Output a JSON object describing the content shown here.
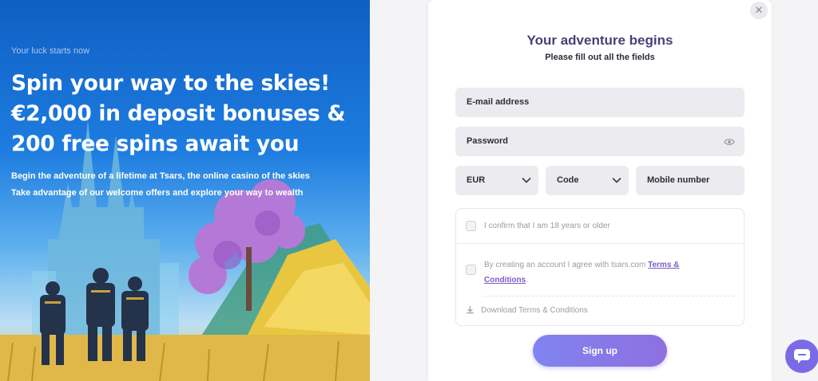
{
  "hero": {
    "tagline": "Your luck starts now",
    "headline": [
      "Spin your way to the skies!",
      "€2,000 in deposit bonuses &",
      "200 free spins await you"
    ],
    "sub": [
      "Begin the adventure of a lifetime at Tsars, the online casino of the skies",
      "Take advantage of our welcome offers and explore your way to wealth"
    ]
  },
  "form": {
    "title": "Your adventure begins",
    "subtitle": "Please fill out all the fields",
    "email_placeholder": "E-mail address",
    "password_placeholder": "Password",
    "currency_value": "EUR",
    "code_value": "Code",
    "mobile_placeholder": "Mobile number",
    "age_confirm": "I confirm that I am 18 years or older",
    "terms_prefix": "By creating an account I agree with tsars.com ",
    "terms_link": "Terms & Conditions",
    "terms_suffix": ".",
    "download_terms": "Download Terms & Conditions",
    "signup_label": "Sign up"
  },
  "icons": {
    "close": "close-icon",
    "eye": "eye-icon",
    "chevron": "chevron-down-icon",
    "download": "download-icon",
    "chat": "chat-icon"
  },
  "colors": {
    "accent": "#7b5cc9",
    "title": "#4a3f77",
    "button_start": "#7f84f0",
    "button_end": "#8f6fe0",
    "chat": "#7b6ae6"
  }
}
